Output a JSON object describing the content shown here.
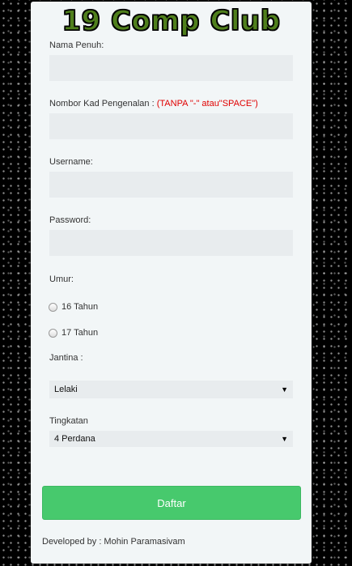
{
  "title": "19 Comp Club",
  "fields": {
    "nama_label": "Nama Penuh:",
    "ic_label": "Nombor Kad Pengenalan :",
    "ic_note": "(TANPA \"-\" atau\"SPACE\")",
    "username_label": "Username:",
    "password_label": "Password:"
  },
  "umur": {
    "label": "Umur:",
    "options": [
      "16 Tahun",
      "17 Tahun"
    ]
  },
  "jantina": {
    "label": "Jantina :",
    "selected": "Lelaki"
  },
  "tingkatan": {
    "label": "Tingkatan",
    "selected": "4 Perdana"
  },
  "submit_label": "Daftar",
  "footer": "Developed by : Mohin Paramasivam"
}
